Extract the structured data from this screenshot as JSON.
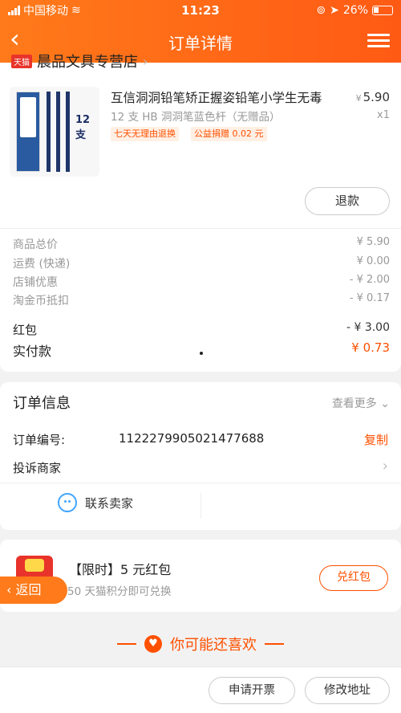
{
  "status_bar": {
    "carrier": "中国移动",
    "time": "11:23",
    "battery": "26%"
  },
  "header": {
    "title": "订单详情"
  },
  "shop": {
    "name": "晨品文具专营店",
    "tag": "天猫"
  },
  "product": {
    "title": "互信洞洞铅笔矫正握姿铅笔小学生无毒",
    "sku": "12 支 HB 洞洞笔蓝色杆（无赠品）",
    "price_symbol": "¥",
    "price": "5.90",
    "qty": "x1",
    "tags": [
      "七天无理由退换",
      "公益捐赠 0.02 元"
    ],
    "image_count_label": "12支",
    "refund_label": "退款"
  },
  "fees": [
    {
      "label": "商品总价",
      "value": "¥ 5.90"
    },
    {
      "label": "运费 (快递)",
      "value": "¥ 0.00"
    },
    {
      "label": "店铺优惠",
      "value": "- ¥ 2.00"
    },
    {
      "label": "淘金币抵扣",
      "value": "- ¥ 0.17"
    },
    {
      "label": "红包",
      "value": "- ¥ 3.00"
    },
    {
      "label": "实付款",
      "value": "¥ 0.73"
    }
  ],
  "order_info": {
    "title": "订单信息",
    "view_more": "查看更多",
    "order_no_label": "订单编号:",
    "order_no": "1122279905021477688",
    "copy_label": "复制",
    "complain_label": "投诉商家",
    "contact_label": "联系卖家"
  },
  "red_packet": {
    "title": "【限时】5 元红包",
    "subtitle": "50 天猫积分即可兑换",
    "exchange_label": "兑红包",
    "back_label": "返回"
  },
  "recommend": {
    "title": "你可能还喜欢"
  },
  "bottom_bar": {
    "invoice_label": "申请开票",
    "modify_address_label": "修改地址"
  },
  "colors": {
    "brand": "#ff5a14",
    "accent_text": "#ff5000"
  }
}
